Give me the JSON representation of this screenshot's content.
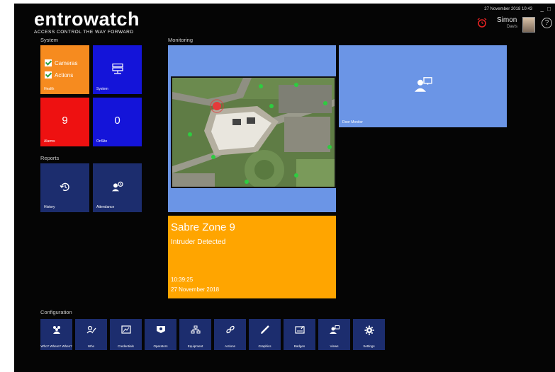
{
  "header": {
    "logo_text": "entrowatch",
    "logo_tagline": "ACCESS CONTROL THE WAY FORWARD",
    "datetime": "27 November 2018 10:43",
    "user_first": "Simon",
    "user_last": "Davis",
    "help_symbol": "?",
    "minimize_symbol": "_",
    "restore_symbol": "□"
  },
  "sections": {
    "system": "System",
    "monitoring": "Monitoring",
    "reports": "Reports",
    "configuration": "Configuration"
  },
  "system_tiles": {
    "health": {
      "label": "Health",
      "cameras": "Cameras",
      "actions": "Actions",
      "color": "#f68b1f"
    },
    "system": {
      "label": "System",
      "color": "#1414d9"
    },
    "alarms": {
      "label": "Alarms",
      "value": "9",
      "color": "#ee1111"
    },
    "onsite": {
      "label": "OnSite",
      "value": "0",
      "color": "#1414d9"
    }
  },
  "report_tiles": {
    "history": {
      "label": "History"
    },
    "attendance": {
      "label": "Attendance"
    }
  },
  "monitoring": {
    "door_monitor_label": "Door Monitor",
    "panel_color": "#6b95e6",
    "alert": {
      "title": "Sabre Zone 9",
      "subtitle": "Intruder Detected",
      "time": "10:39:25",
      "date": "27 November 2018",
      "color": "#ffa500"
    }
  },
  "configuration": {
    "items": [
      {
        "label": "Who? Where? When?",
        "icon": "people-group-icon"
      },
      {
        "label": "Who",
        "icon": "person-pen-icon"
      },
      {
        "label": "Credentials",
        "icon": "credentials-icon"
      },
      {
        "label": "Operators",
        "icon": "operators-icon"
      },
      {
        "label": "Equipment",
        "icon": "equipment-icon"
      },
      {
        "label": "Actions",
        "icon": "link-icon"
      },
      {
        "label": "Graphics",
        "icon": "pencil-icon"
      },
      {
        "label": "Badges",
        "icon": "badge-icon"
      },
      {
        "label": "Views",
        "icon": "monitor-user-icon"
      },
      {
        "label": "Settings",
        "icon": "gear-icon"
      }
    ]
  }
}
